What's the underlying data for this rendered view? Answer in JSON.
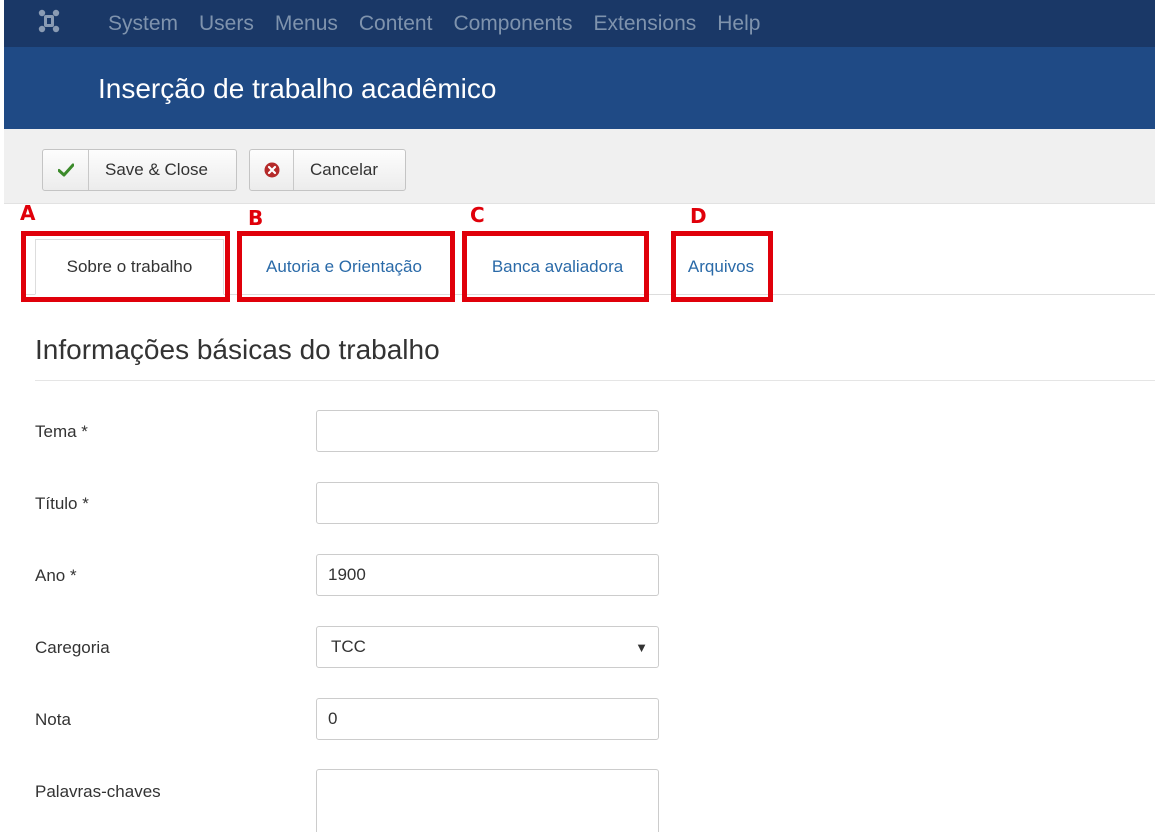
{
  "top_menu": {
    "logo_icon": "joomla-logo-icon",
    "items": [
      "System",
      "Users",
      "Menus",
      "Content",
      "Components",
      "Extensions",
      "Help"
    ]
  },
  "header": {
    "title": "Inserção de trabalho acadêmico"
  },
  "toolbar": {
    "save_close_label": "Save & Close",
    "save_icon": "checkmark-icon",
    "cancel_label": "Cancelar",
    "cancel_icon": "cancel-circle-icon"
  },
  "annotations": {
    "letters": [
      "A",
      "B",
      "C",
      "D"
    ],
    "highlight_color": "#e0000a"
  },
  "tabs": [
    {
      "label": "Sobre o trabalho",
      "active": true
    },
    {
      "label": "Autoria e Orientação",
      "active": false
    },
    {
      "label": "Banca avaliadora",
      "active": false
    },
    {
      "label": "Arquivos",
      "active": false
    }
  ],
  "section": {
    "title": "Informações básicas do trabalho"
  },
  "form": {
    "tema": {
      "label": "Tema *",
      "value": ""
    },
    "titulo": {
      "label": "Título *",
      "value": ""
    },
    "ano": {
      "label": "Ano *",
      "value": "1900"
    },
    "categoria": {
      "label": "Caregoria",
      "selected": "TCC"
    },
    "nota": {
      "label": "Nota",
      "value": "0"
    },
    "palavras_chaves": {
      "label": "Palavras-chaves",
      "value": ""
    }
  },
  "colors": {
    "top_nav_bg": "#1a3867",
    "header_bg": "#1f4a85",
    "link": "#2a6aa8",
    "save_check": "#3b8a2a",
    "cancel_red": "#b52a2a"
  }
}
